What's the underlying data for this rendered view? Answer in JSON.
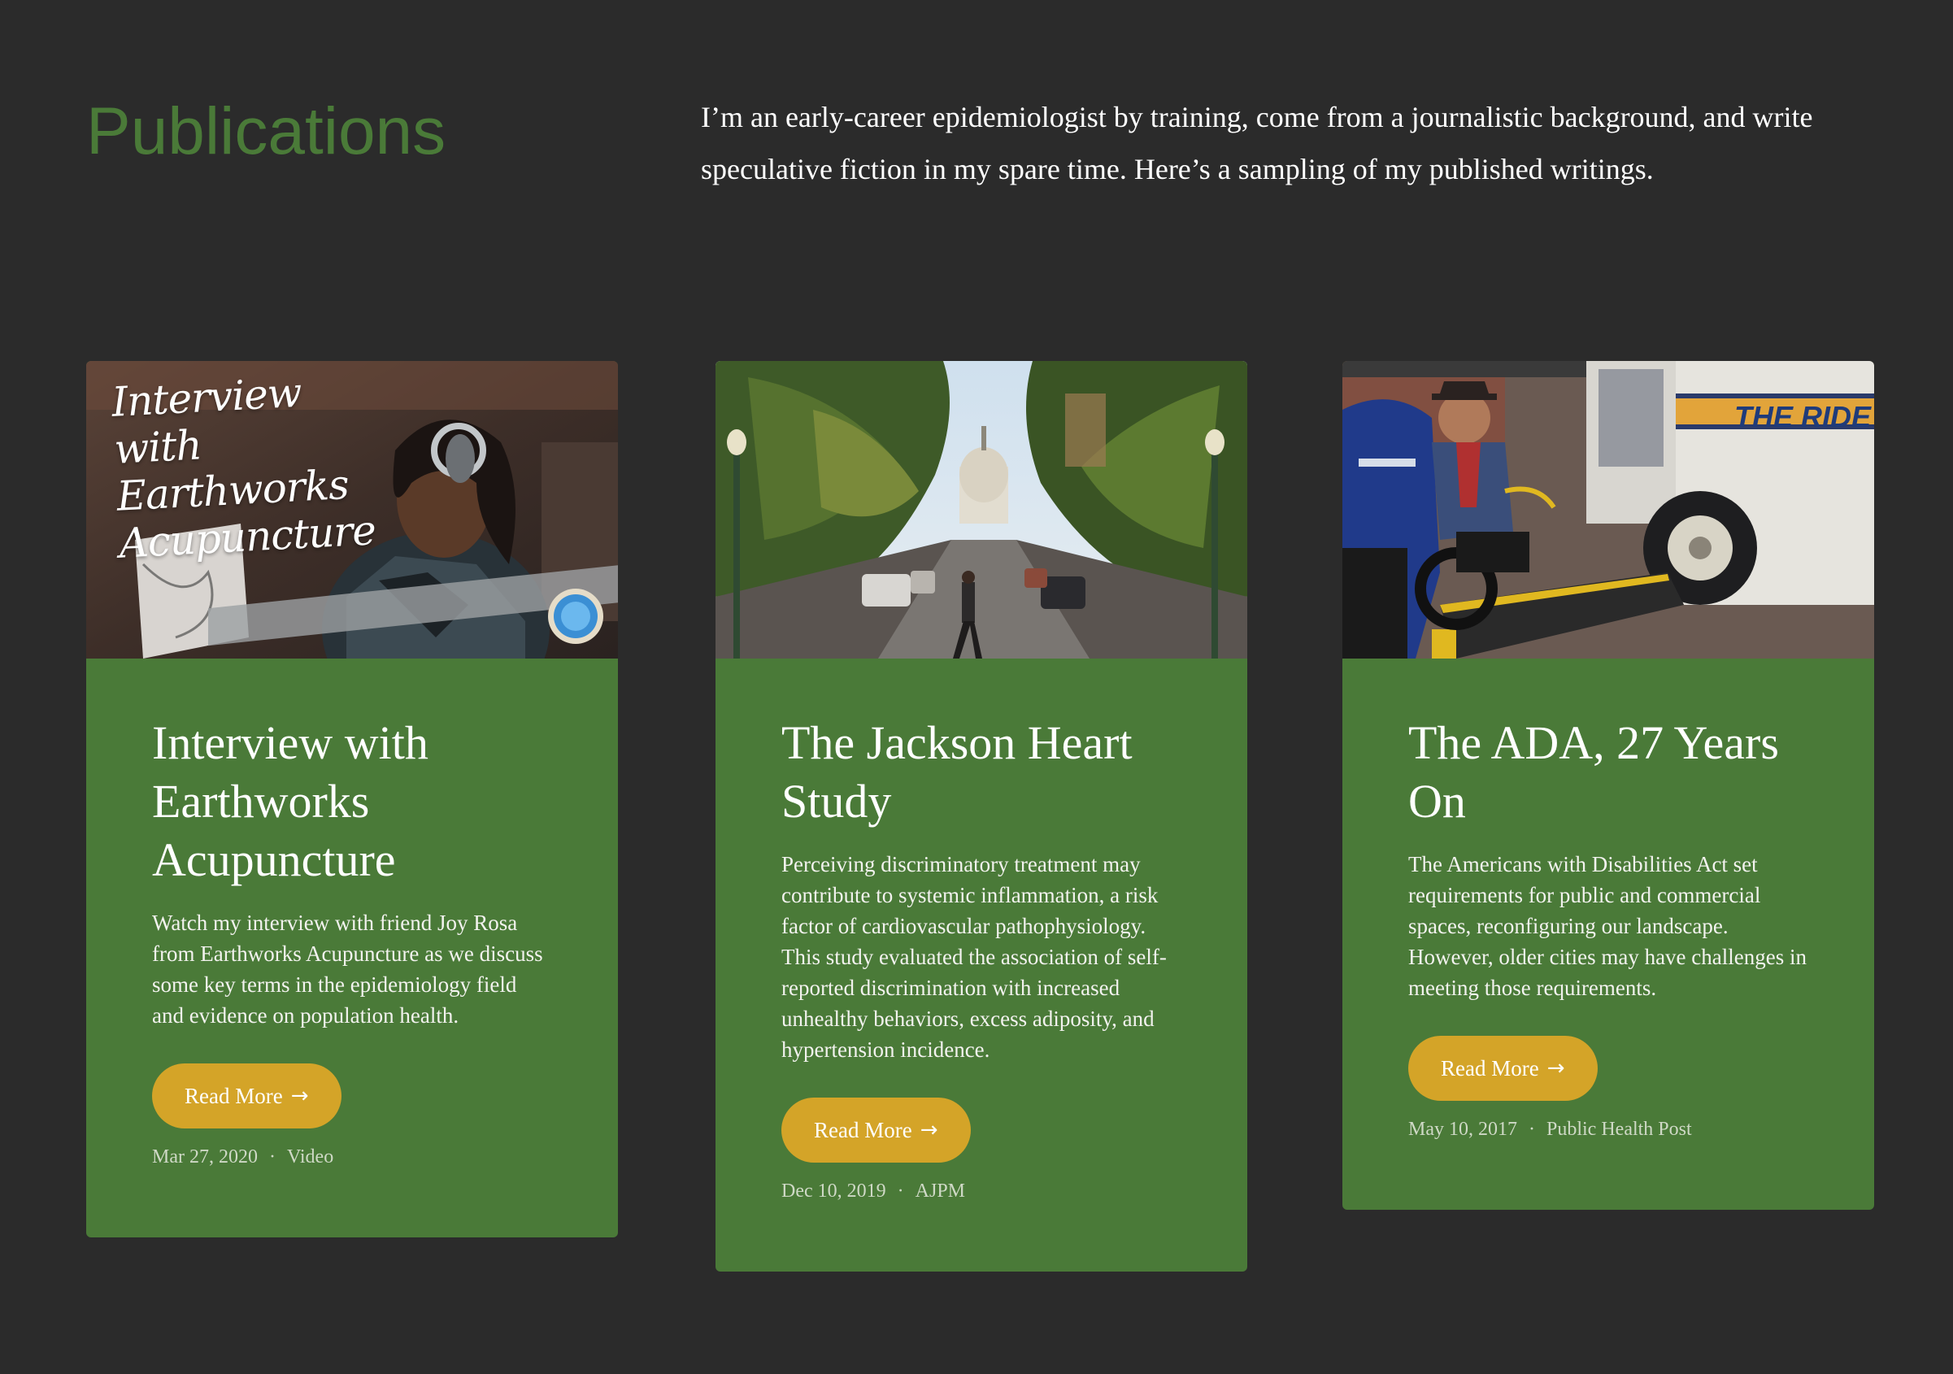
{
  "header": {
    "title": "Publications",
    "intro": "I’m an early-career epidemiologist by training, come from a journalistic background, and write speculative fiction in my spare time. Here’s a sampling of my published writings."
  },
  "colors": {
    "background": "#2b2b2b",
    "accent_green": "#4a7a38",
    "button_gold": "#d4a428"
  },
  "cards": [
    {
      "title": "Interview with Earthworks Acupuncture",
      "image_caption": "Interview with Earthworks Acupuncture",
      "description": "Watch my interview with friend Joy Rosa from Earthworks Acupuncture as we discuss some key terms in the epidemiology field and evidence on population health.",
      "button_label": "Read More",
      "button_icon": "arrow-right-icon",
      "date": "Mar 27, 2020",
      "separator": "·",
      "source": "Video"
    },
    {
      "title": "The Jackson Heart Study",
      "description": "Perceiving discriminatory treatment may contribute to systemic inflammation, a risk factor of cardiovascular pathophysiology. This study evaluated the association of self-reported discrimination with increased unhealthy behaviors, excess adiposity, and hypertension incidence.",
      "button_label": "Read More",
      "button_icon": "arrow-right-icon",
      "date": "Dec 10, 2019",
      "separator": "·",
      "source": "AJPM"
    },
    {
      "title": "The ADA, 27 Years On",
      "image_caption": "THE RIDE",
      "description": "The Americans with Disabilities Act set requirements for public and commercial spaces, reconfiguring our landscape. However, older cities may have challenges in meeting those requirements.",
      "button_label": "Read More",
      "button_icon": "arrow-right-icon",
      "date": "May 10, 2017",
      "separator": "·",
      "source": "Public Health Post"
    }
  ]
}
